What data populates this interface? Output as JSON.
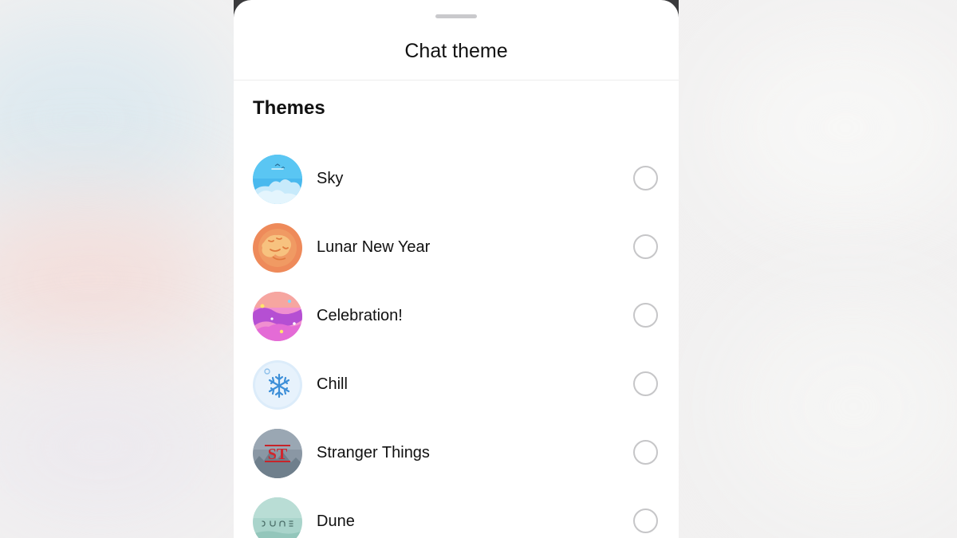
{
  "sheet": {
    "title": "Chat theme",
    "section_title": "Themes"
  },
  "themes": [
    {
      "label": "Sky",
      "selected": false,
      "icon": "sky-clouds-icon"
    },
    {
      "label": "Lunar New Year",
      "selected": false,
      "icon": "tiger-icon"
    },
    {
      "label": "Celebration!",
      "selected": false,
      "icon": "confetti-icon"
    },
    {
      "label": "Chill",
      "selected": false,
      "icon": "snowflake-icon"
    },
    {
      "label": "Stranger Things",
      "selected": false,
      "icon": "stranger-things-logo-icon",
      "logo_text": "ST"
    },
    {
      "label": "Dune",
      "selected": false,
      "icon": "dune-logo-icon",
      "logo_text": "DUNE"
    }
  ],
  "colors": {
    "sheet_background": "#ffffff",
    "radio_border": "#c6c6c8",
    "text": "#111111"
  }
}
